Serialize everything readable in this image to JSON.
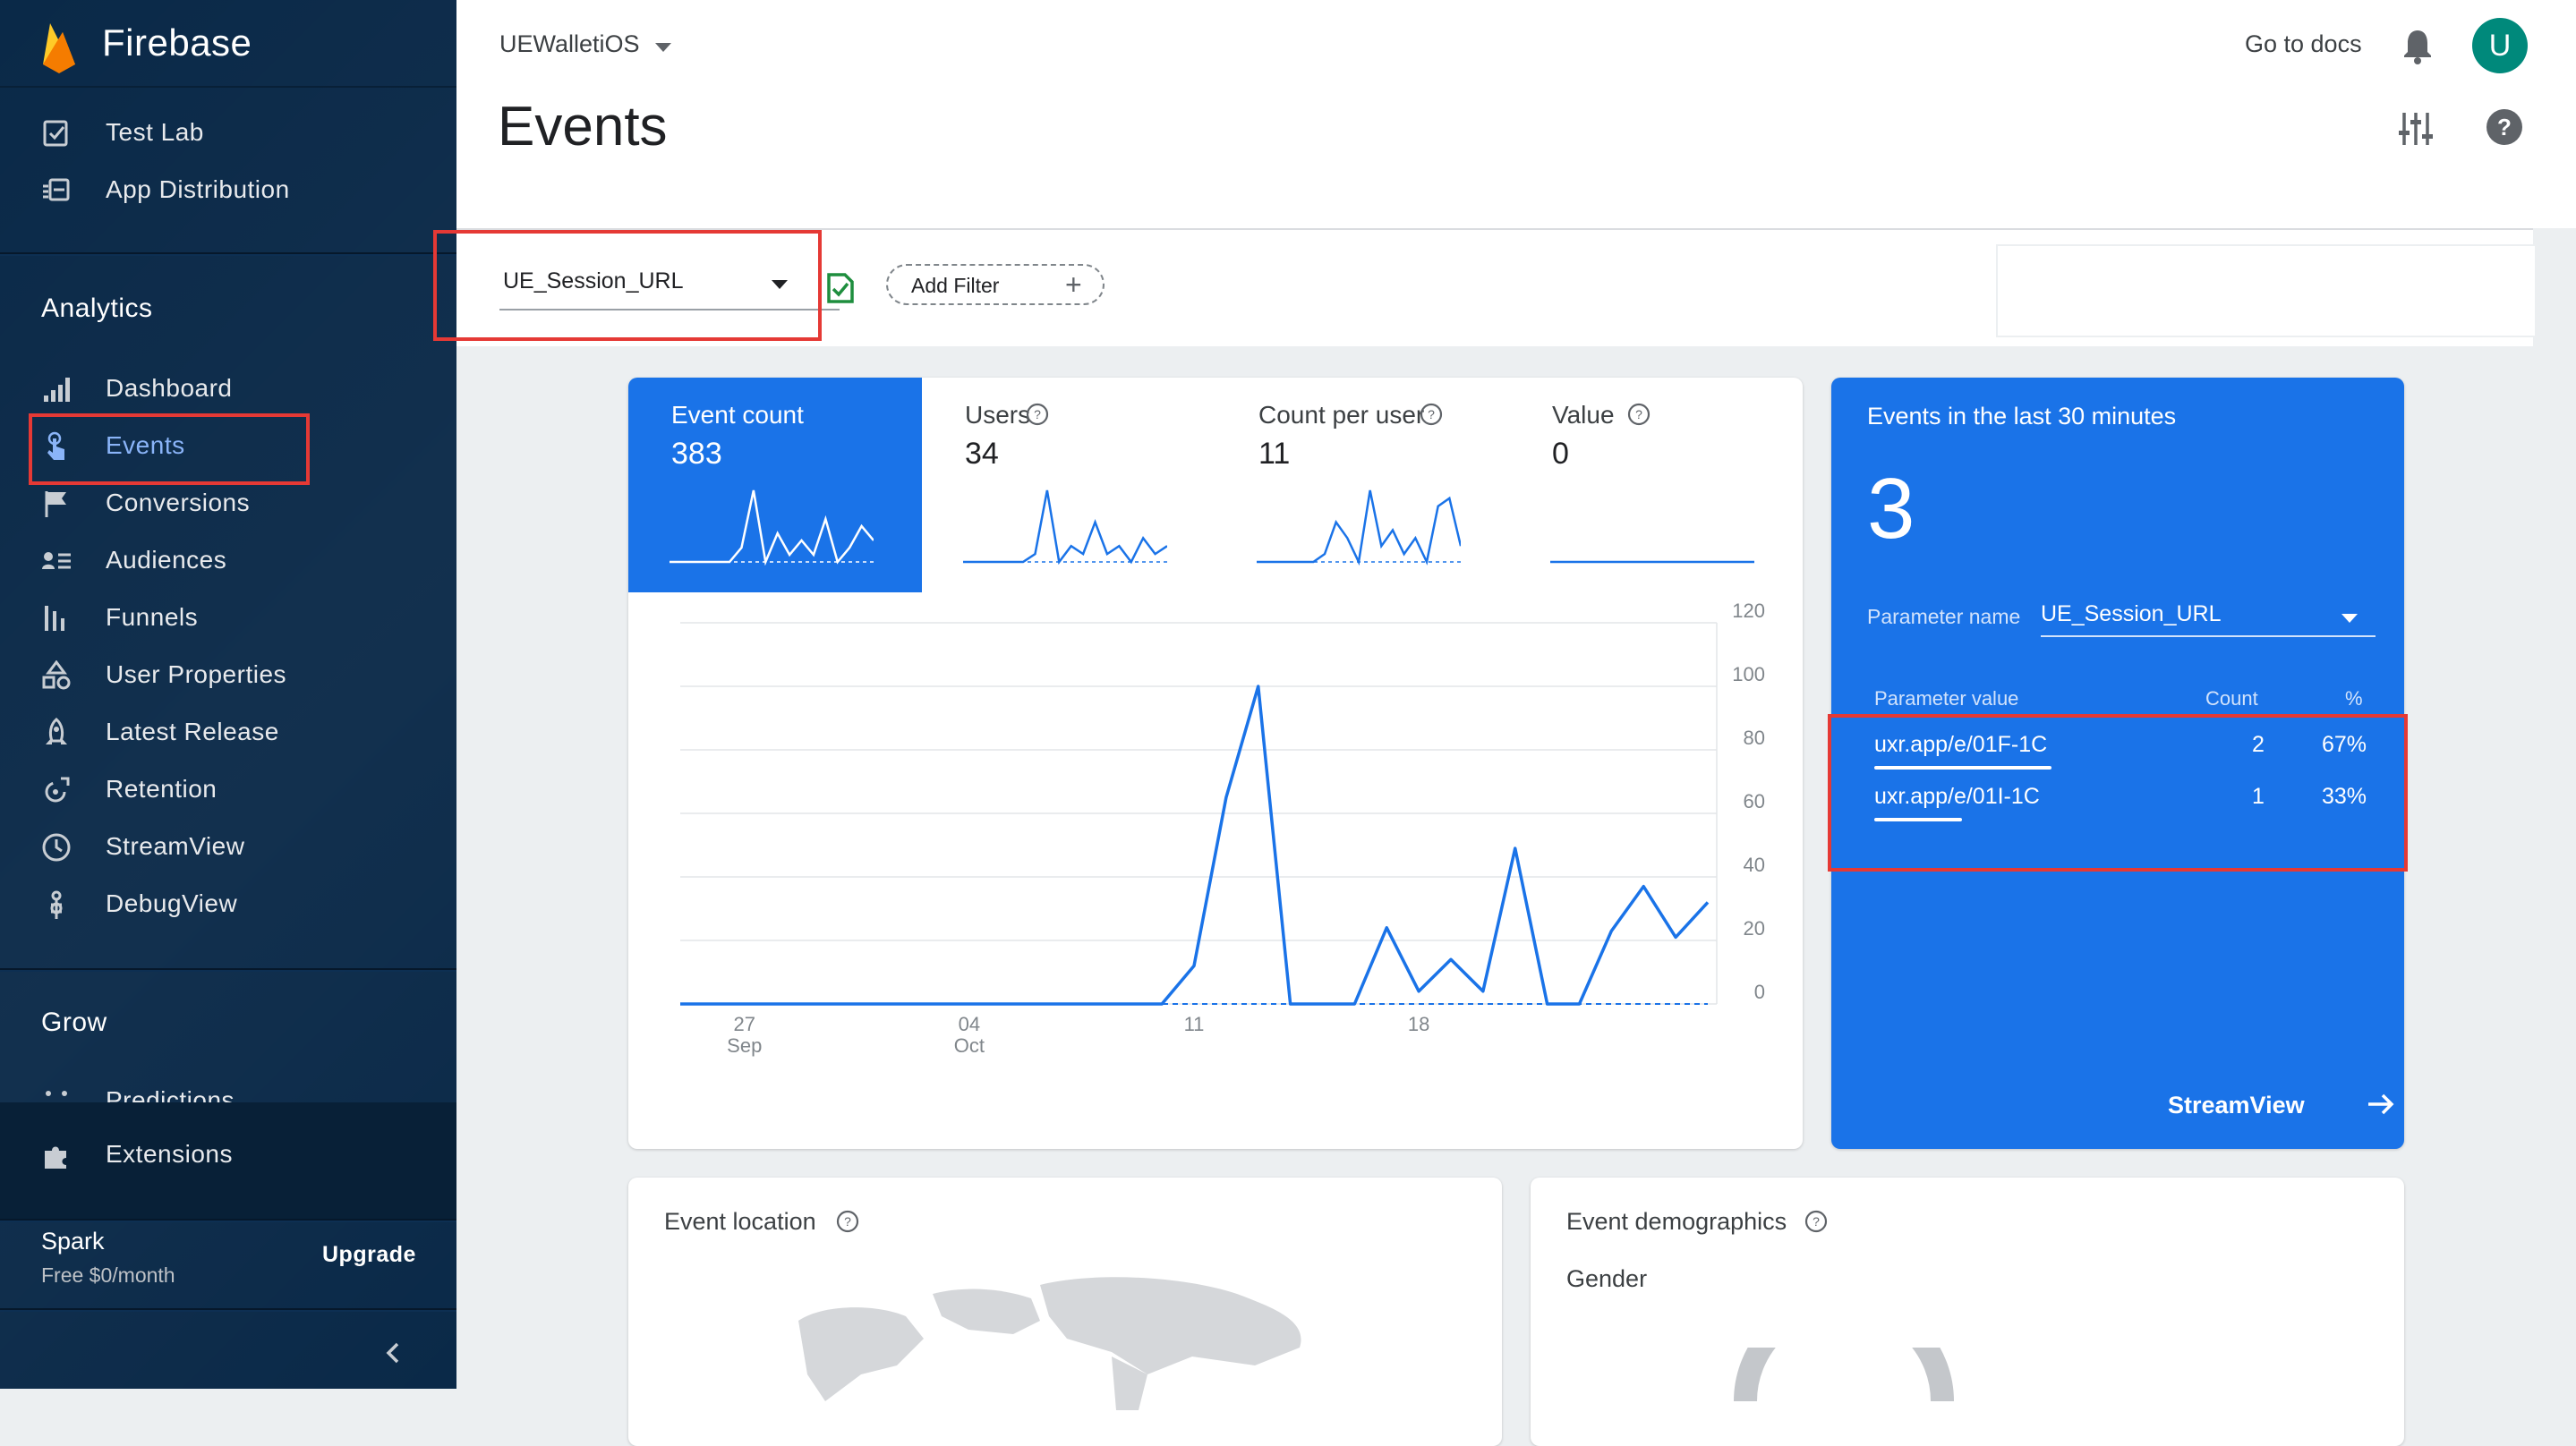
{
  "brand": {
    "name": "Firebase"
  },
  "sidebar": {
    "top_items": [
      {
        "label": "Test Lab",
        "icon": "test-lab-icon"
      },
      {
        "label": "App Distribution",
        "icon": "app-distribution-icon"
      }
    ],
    "analytics_title": "Analytics",
    "analytics_items": [
      {
        "label": "Dashboard",
        "icon": "dashboard-icon"
      },
      {
        "label": "Events",
        "icon": "events-icon",
        "active": true
      },
      {
        "label": "Conversions",
        "icon": "flag-icon"
      },
      {
        "label": "Audiences",
        "icon": "audiences-icon"
      },
      {
        "label": "Funnels",
        "icon": "funnels-icon"
      },
      {
        "label": "User Properties",
        "icon": "user-properties-icon"
      },
      {
        "label": "Latest Release",
        "icon": "rocket-icon"
      },
      {
        "label": "Retention",
        "icon": "retention-icon"
      },
      {
        "label": "StreamView",
        "icon": "clock-icon"
      },
      {
        "label": "DebugView",
        "icon": "debug-icon"
      }
    ],
    "grow_title": "Grow",
    "grow_partial_item": "Predictions",
    "extensions_label": "Extensions",
    "plan": {
      "name": "Spark",
      "price": "Free $0/month",
      "upgrade": "Upgrade"
    }
  },
  "header": {
    "project": "UEWalletiOS",
    "title": "Events",
    "docs_link": "Go to docs",
    "avatar_letter": "U"
  },
  "filter": {
    "event_name": "UE_Session_URL",
    "add_filter": "Add Filter"
  },
  "metrics": [
    {
      "label": "Event count",
      "value": "383",
      "active": true,
      "help": false
    },
    {
      "label": "Users",
      "value": "34",
      "active": false,
      "help": true
    },
    {
      "label": "Count per user",
      "value": "11",
      "active": false,
      "help": true
    },
    {
      "label": "Value",
      "value": "0",
      "active": false,
      "help": true
    }
  ],
  "chart_data": {
    "type": "line",
    "x": [
      0,
      1,
      2,
      3,
      4,
      5,
      6,
      7,
      8,
      9,
      10,
      11,
      12,
      13,
      14,
      15,
      16,
      17,
      18,
      19,
      20,
      21,
      22,
      23,
      24,
      25,
      26,
      27,
      28
    ],
    "x_tick_labels": [
      {
        "index": 2,
        "day": "27",
        "month": "Sep"
      },
      {
        "index": 9,
        "day": "04",
        "month": "Oct"
      },
      {
        "index": 16,
        "day": "11",
        "month": ""
      },
      {
        "index": 23,
        "day": "18",
        "month": ""
      }
    ],
    "series": [
      {
        "values": [
          0,
          0,
          0,
          0,
          0,
          0,
          0,
          0,
          0,
          0,
          0,
          0,
          0,
          0,
          0,
          0,
          12,
          65,
          100,
          0,
          0,
          0,
          24,
          4,
          14,
          4,
          49,
          0,
          0,
          23,
          37,
          21,
          32
        ]
      }
    ],
    "y_ticks": [
      0,
      20,
      40,
      60,
      80,
      100,
      120
    ],
    "ylim": [
      0,
      120
    ],
    "grid": true,
    "axis_side": "right"
  },
  "sparklines": {
    "event_count": [
      0,
      0,
      0,
      0,
      0,
      0,
      2,
      10,
      0,
      4,
      1,
      3,
      1,
      6,
      0,
      2,
      5,
      3
    ],
    "users": [
      0,
      0,
      0,
      0,
      0,
      0,
      1,
      9,
      0,
      2,
      1,
      5,
      1,
      2,
      0,
      3,
      1,
      2
    ],
    "count_per_user": [
      0,
      0,
      0,
      0,
      0,
      0,
      1,
      5,
      3,
      0,
      9,
      2,
      4,
      1,
      3,
      0,
      7,
      8,
      2
    ],
    "value": [
      0,
      0,
      0,
      0,
      0,
      0,
      0,
      0,
      0,
      0
    ]
  },
  "realtime": {
    "title": "Events in the last 30 minutes",
    "count": "3",
    "param_label": "Parameter name",
    "param_value": "UE_Session_URL",
    "columns": {
      "value": "Parameter value",
      "count": "Count",
      "pct": "%"
    },
    "rows": [
      {
        "value": "uxr.app/e/01F-1C",
        "count": "2",
        "pct": "67%",
        "share": 0.67
      },
      {
        "value": "uxr.app/e/01I-1C",
        "count": "1",
        "pct": "33%",
        "share": 0.33
      }
    ],
    "link": "StreamView"
  },
  "location_card": {
    "title": "Event location"
  },
  "demographics_card": {
    "title": "Event demographics",
    "subtitle": "Gender"
  },
  "colors": {
    "sidebar_bg": "#0a2948",
    "accent": "#1a73e8",
    "highlight": "#e53935",
    "active_nav": "#8ab4f8"
  }
}
